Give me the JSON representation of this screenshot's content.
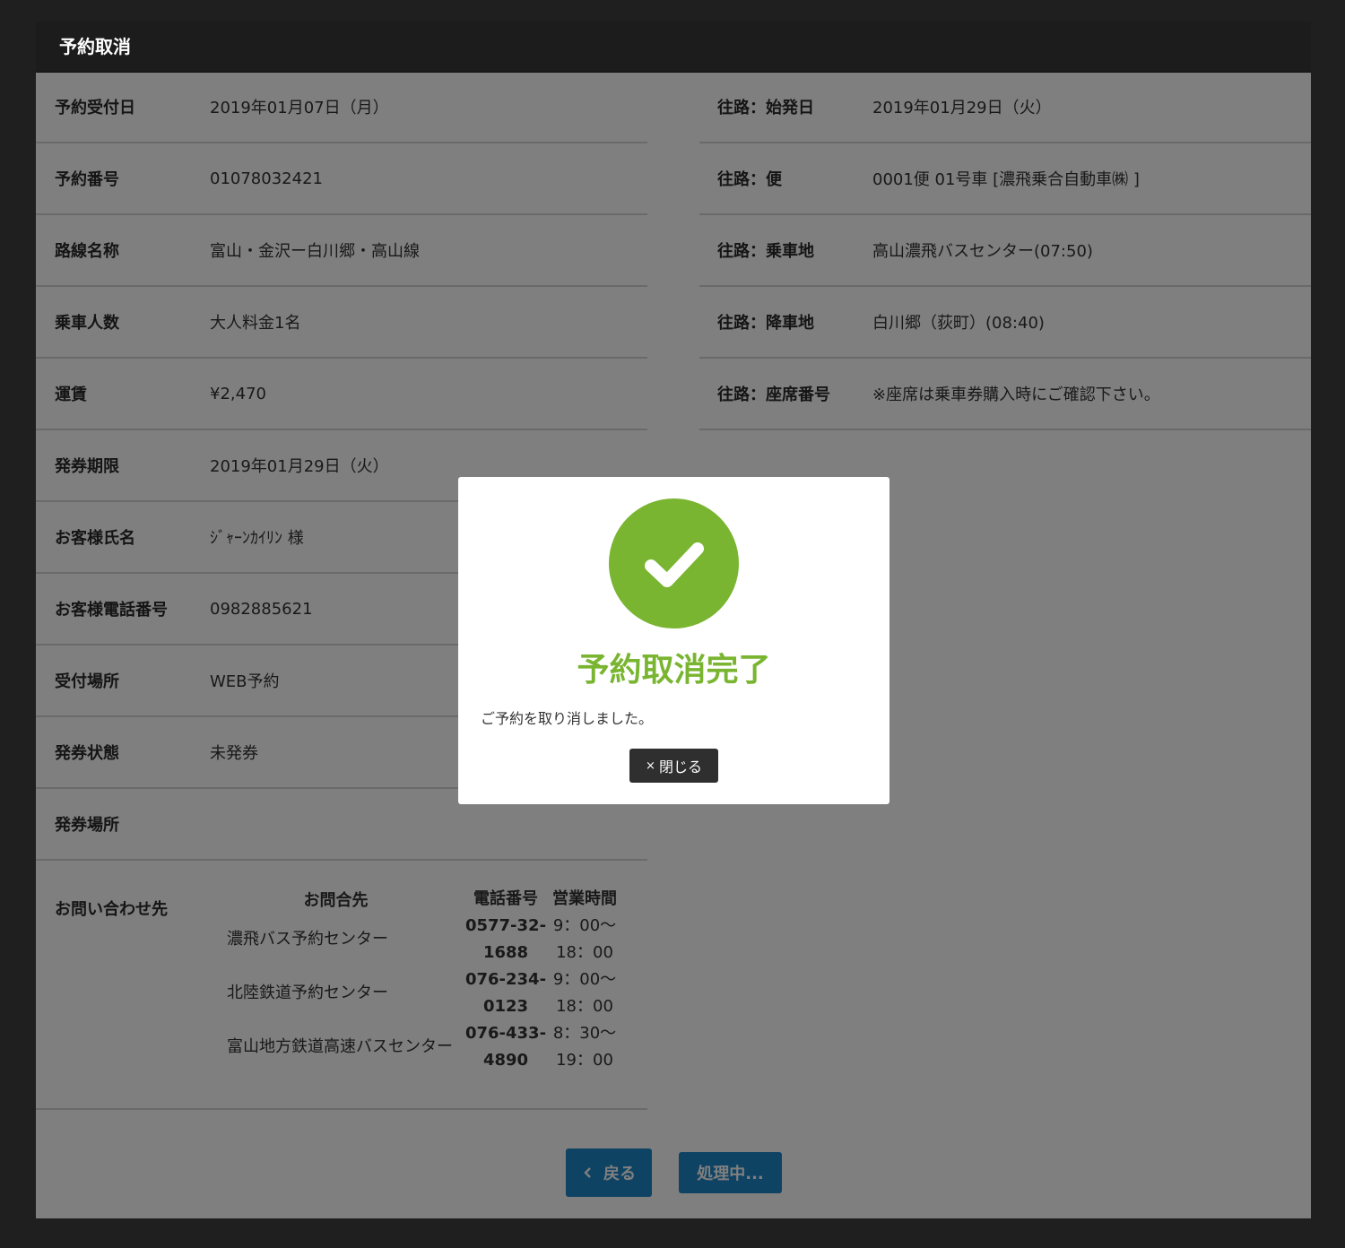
{
  "header": {
    "title": "予約取消"
  },
  "left_fields": [
    {
      "label": "予約受付日",
      "value": "2019年01月07日（月）"
    },
    {
      "label": "予約番号",
      "value": "01078032421"
    },
    {
      "label": "路線名称",
      "value": "富山・金沢ー白川郷・高山線"
    },
    {
      "label": "乗車人数",
      "value": "大人料金1名"
    },
    {
      "label": "運賃",
      "value": "¥2,470"
    },
    {
      "label": "発券期限",
      "value": "2019年01月29日（火）"
    },
    {
      "label": "お客様氏名",
      "value": "ｼﾞｬｰﾝｶｲﾘﾝ 様"
    },
    {
      "label": "お客様電話番号",
      "value": "0982885621"
    },
    {
      "label": "受付場所",
      "value": "WEB予約"
    },
    {
      "label": "発券状態",
      "value": "未発券"
    },
    {
      "label": "発券場所",
      "value": ""
    }
  ],
  "right_fields": [
    {
      "label": "往路：始発日",
      "value": "2019年01月29日（火）"
    },
    {
      "label": "往路：便",
      "value": "0001便 01号車 [濃飛乗合自動車㈱ ]"
    },
    {
      "label": "往路：乗車地",
      "value": "高山濃飛バスセンター(07:50)"
    },
    {
      "label": "往路：降車地",
      "value": "白川郷（荻町）(08:40)"
    },
    {
      "label": "往路：座席番号",
      "value": "※座席は乗車券購入時にご確認下さい。"
    }
  ],
  "contact": {
    "label": "お問い合わせ先",
    "headers": [
      "お問合先",
      "電話番号",
      "営業時間"
    ],
    "rows": [
      {
        "name": "濃飛バス予約センター",
        "phone1": "0577-32-",
        "phone2": "1688",
        "hours1": "9：00〜",
        "hours2": "18：00"
      },
      {
        "name": "北陸鉄道予約センター",
        "phone1": "076-234-",
        "phone2": "0123",
        "hours1": "9：00〜",
        "hours2": "18：00"
      },
      {
        "name": "富山地方鉄道高速バスセンター",
        "phone1": "076-433-",
        "phone2": "4890",
        "hours1": "8：30〜",
        "hours2": "19：00"
      }
    ]
  },
  "buttons": {
    "back": "戻る",
    "processing": "処理中..."
  },
  "modal": {
    "title": "予約取消完了",
    "message": "ご予約を取り消しました。",
    "close_label": "閉じる",
    "accent": "#79b530"
  }
}
